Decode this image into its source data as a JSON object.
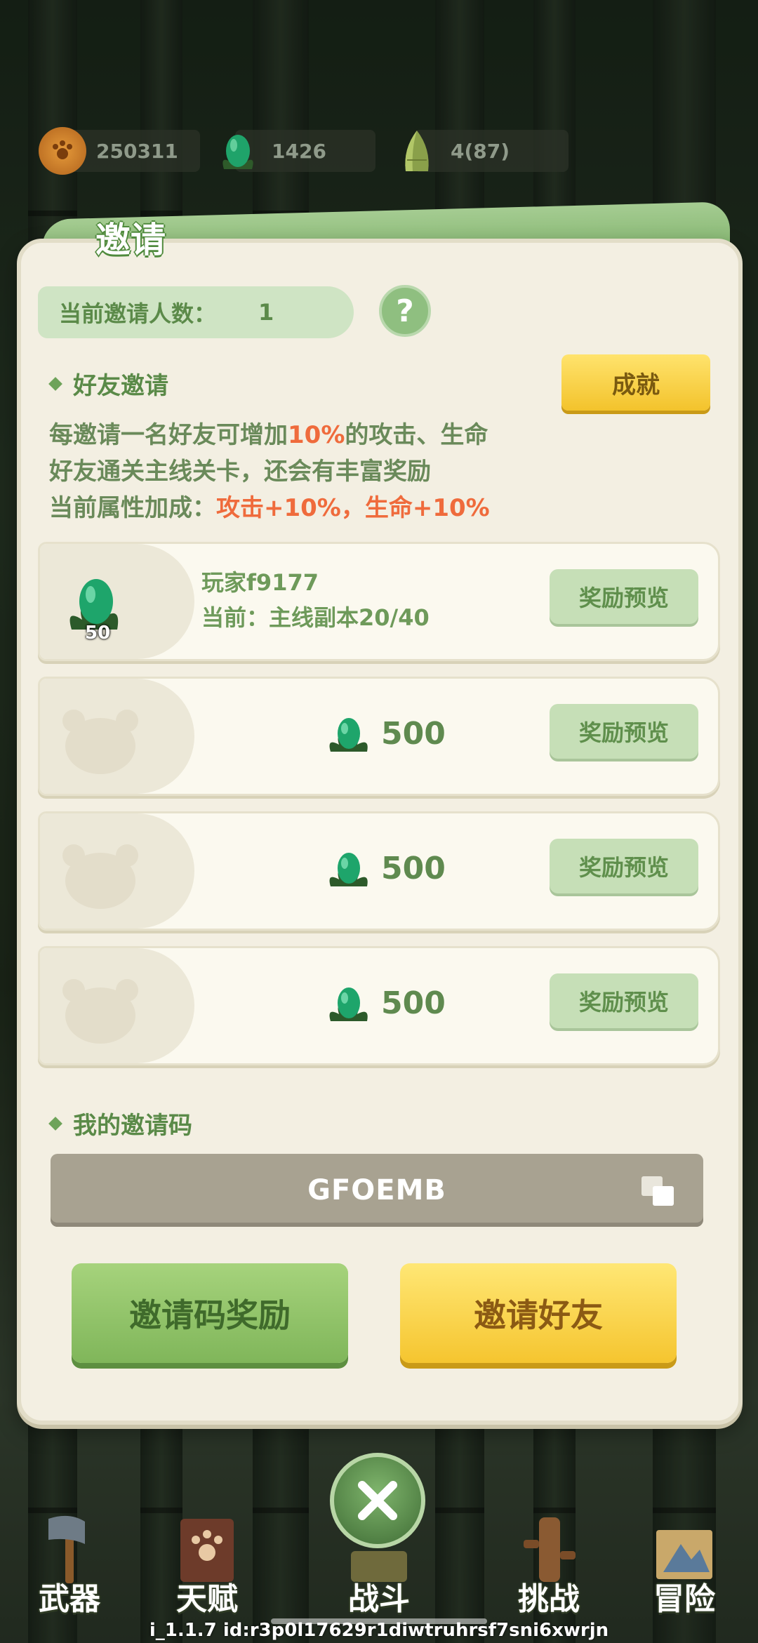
{
  "resources": [
    {
      "icon": "paw-coin-icon",
      "value": "250311"
    },
    {
      "icon": "green-egg-icon",
      "value": "1426"
    },
    {
      "icon": "bamboo-shoot-icon",
      "value": "4(87)"
    }
  ],
  "modal": {
    "title": "邀请",
    "invite_count_label": "当前邀请人数：",
    "invite_count_value": "1",
    "help_label": "?",
    "friend_invite_header": "好友邀请",
    "achievement_button": "成就",
    "desc_line1_pre": "每邀请一名好友可增加",
    "desc_line1_hl": "10%",
    "desc_line1_post": "的攻击、生命",
    "desc_line2": "好友通关主线关卡，还会有丰富奖励",
    "desc_line3_pre": "当前属性加成：",
    "desc_line3_hl": "攻击+10%，生命+10%"
  },
  "friends": [
    {
      "avatar_badge": "50",
      "name": "玩家f9177",
      "progress": "当前：主线副本20/40",
      "preview_button": "奖励预览"
    },
    {
      "reward_amount": "500",
      "preview_button": "奖励预览"
    },
    {
      "reward_amount": "500",
      "preview_button": "奖励预览"
    },
    {
      "reward_amount": "500",
      "preview_button": "奖励预览"
    }
  ],
  "invite_code": {
    "header": "我的邀请码",
    "code": "GFOEMB"
  },
  "buttons": {
    "code_reward": "邀请码奖励",
    "invite_friend": "邀请好友"
  },
  "nav": [
    {
      "label": "武器",
      "icon": "axe-icon"
    },
    {
      "label": "天赋",
      "icon": "paw-book-icon"
    },
    {
      "label": "战斗",
      "icon": "scroll-icon"
    },
    {
      "label": "挑战",
      "icon": "wooden-dummy-icon"
    },
    {
      "label": "冒险",
      "icon": "map-icon"
    }
  ],
  "version": "i_1.1.7 id:r3p0l17629r1diwtruhrsf7sni6xwrjn",
  "colors": {
    "accent_green": "#7fb26a",
    "highlight_orange": "#ef6b3c",
    "button_yellow": "#f5c52f"
  }
}
